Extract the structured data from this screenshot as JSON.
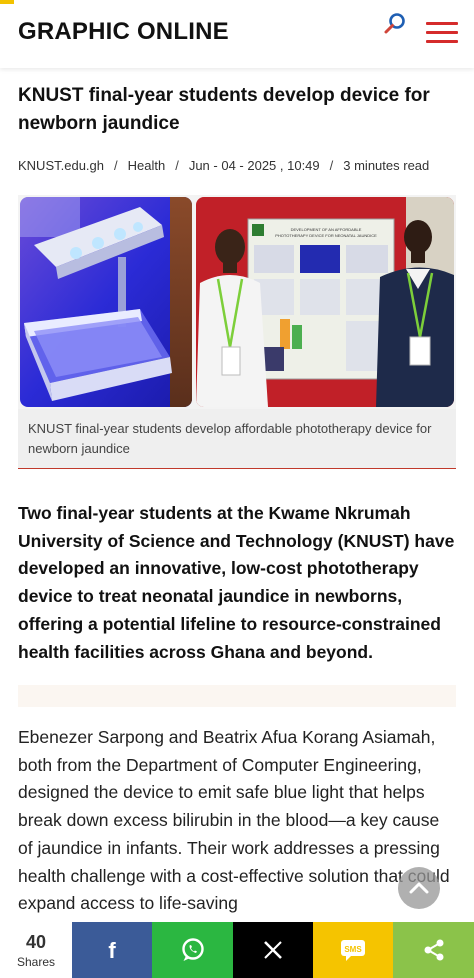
{
  "header": {
    "logo": "GRAPHIC ONLINE",
    "search_icon": "search-icon",
    "menu_icon": "hamburger-menu-icon",
    "accent_color": "#d52b2b"
  },
  "article": {
    "headline": "KNUST final-year students develop device for newborn jaundice",
    "meta": {
      "source": "KNUST.edu.gh",
      "category": "Health",
      "date": "Jun - 04 - 2025 , 10:49",
      "read_time": "3 minutes read"
    },
    "image_caption": "KNUST final-year students develop affordable phototherapy device for newborn jaundice",
    "poster_text": "DEVELOPMENT OF AN AFFORDABLE PHOTOTHERAPY DEVICE FOR NEONATAL JAUNDICE",
    "lede": "Two final-year students at the Kwame Nkrumah University of Science and Technology (KNUST) have developed an innovative, low-cost phototherapy device to treat neonatal jaundice in newborns, offering a potential lifeline to resource-constrained health facilities across Ghana and beyond.",
    "body": "Ebenezer Sarpong and Beatrix Afua Korang Asiamah, both from the Department of Computer Engineering, designed the device to emit safe blue light that helps break down excess bilirubin in the blood—a key cause of jaundice in infants. Their work addresses a pressing health challenge with a cost-effective solution that could expand access to life-saving"
  },
  "share": {
    "count": "40",
    "count_label": "Shares",
    "sms_label": "SMS",
    "buttons": [
      "facebook-icon",
      "whatsapp-icon",
      "x-icon",
      "sms-icon",
      "share-icon"
    ],
    "colors": {
      "facebook": "#3b5b98",
      "whatsapp": "#2bb741",
      "x": "#000000",
      "sms": "#f5c400",
      "share": "#8bc34a"
    }
  },
  "scroll_top_icon": "chevron-up-icon"
}
